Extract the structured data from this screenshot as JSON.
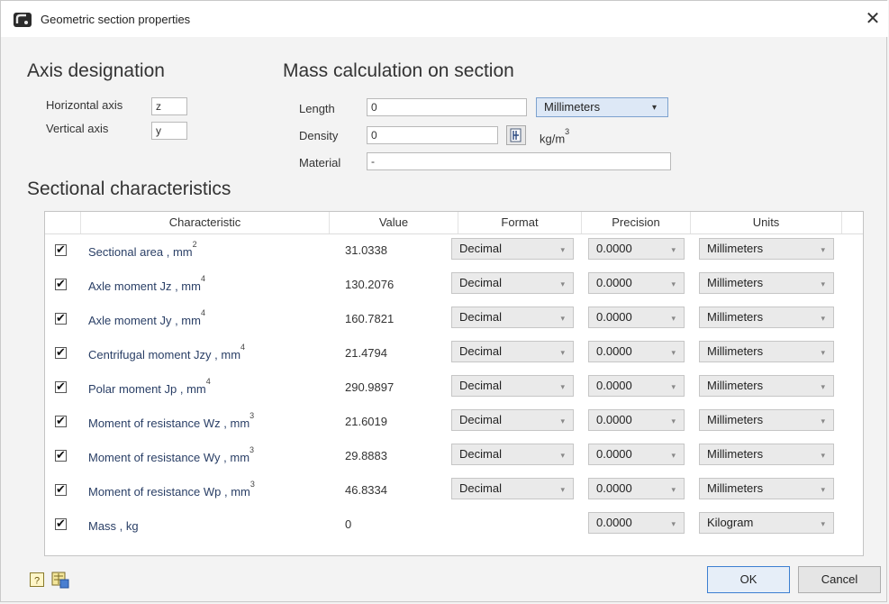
{
  "window": {
    "title": "Geometric section properties"
  },
  "axis": {
    "heading": "Axis designation",
    "horizontal_label": "Horizontal axis",
    "horizontal_value": "z",
    "vertical_label": "Vertical axis",
    "vertical_value": "y"
  },
  "mass": {
    "heading": "Mass calculation on section",
    "length_label": "Length",
    "length_value": "0",
    "length_units": "Millimeters",
    "density_label": "Density",
    "density_value": "0",
    "density_units": "kg/m",
    "density_units_exp": "3",
    "material_label": "Material",
    "material_value": "-"
  },
  "sectional": {
    "heading": "Sectional characteristics",
    "columns": {
      "characteristic": "Characteristic",
      "value": "Value",
      "format": "Format",
      "precision": "Precision",
      "units": "Units"
    },
    "rows": [
      {
        "name": "Sectional area ,  mm",
        "exp": "2",
        "value": "31.0338",
        "format": "Decimal",
        "precision": "0.0000",
        "units": "Millimeters"
      },
      {
        "name": "Axle moment Jz ,  mm",
        "exp": "4",
        "value": "130.2076",
        "format": "Decimal",
        "precision": "0.0000",
        "units": "Millimeters"
      },
      {
        "name": "Axle moment Jy ,  mm",
        "exp": "4",
        "value": "160.7821",
        "format": "Decimal",
        "precision": "0.0000",
        "units": "Millimeters"
      },
      {
        "name": "Centrifugal moment Jzy ,  mm",
        "exp": "4",
        "value": "21.4794",
        "format": "Decimal",
        "precision": "0.0000",
        "units": "Millimeters"
      },
      {
        "name": "Polar moment Jp ,  mm",
        "exp": "4",
        "value": "290.9897",
        "format": "Decimal",
        "precision": "0.0000",
        "units": "Millimeters"
      },
      {
        "name": "Moment of resistance Wz ,  mm",
        "exp": "3",
        "value": "21.6019",
        "format": "Decimal",
        "precision": "0.0000",
        "units": "Millimeters"
      },
      {
        "name": "Moment of resistance Wy ,  mm",
        "exp": "3",
        "value": "29.8883",
        "format": "Decimal",
        "precision": "0.0000",
        "units": "Millimeters"
      },
      {
        "name": "Moment of resistance Wp ,  mm",
        "exp": "3",
        "value": "46.8334",
        "format": "Decimal",
        "precision": "0.0000",
        "units": "Millimeters"
      },
      {
        "name": "Mass ,  kg",
        "exp": "",
        "value": "0",
        "format": "",
        "precision": "0.0000",
        "units": "Kilogram"
      }
    ]
  },
  "buttons": {
    "ok": "OK",
    "cancel": "Cancel"
  },
  "icons": {
    "close": "✕",
    "check": "✔",
    "dropdown": "▾"
  }
}
